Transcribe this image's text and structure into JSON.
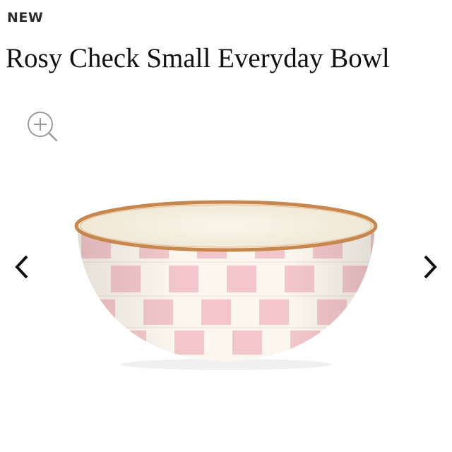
{
  "product": {
    "badge": "NEW",
    "title": "Rosy Check Small Everyday Bowl"
  },
  "icons": {
    "zoom": "zoom-in-icon",
    "prev": "chevron-left-icon",
    "next": "chevron-right-icon"
  },
  "colors": {
    "check_pink": "#f3c4c8",
    "check_white": "#fbf7ee",
    "rim_gold": "#c8864f",
    "interior": "#f6f1e3"
  }
}
